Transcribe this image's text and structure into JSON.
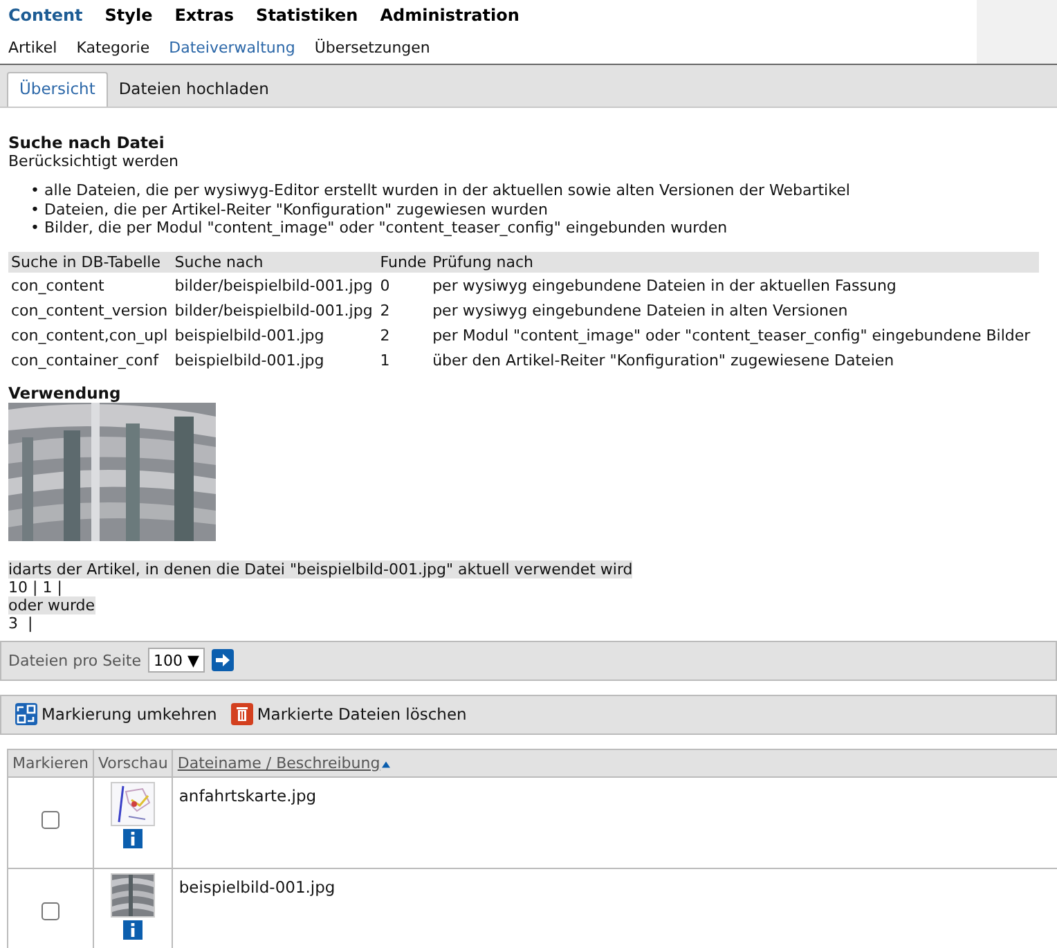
{
  "main_menu": [
    {
      "label": "Content",
      "selected": true
    },
    {
      "label": "Style",
      "selected": false
    },
    {
      "label": "Extras",
      "selected": false
    },
    {
      "label": "Statistiken",
      "selected": false
    },
    {
      "label": "Administration",
      "selected": false
    }
  ],
  "sub_menu": [
    {
      "label": "Artikel",
      "selected": false
    },
    {
      "label": "Kategorie",
      "selected": false
    },
    {
      "label": "Dateiverwaltung",
      "selected": true
    },
    {
      "label": "Übersetzungen",
      "selected": false
    }
  ],
  "tabs": [
    {
      "label": "Übersicht",
      "selected": true
    },
    {
      "label": "Dateien hochladen",
      "selected": false
    }
  ],
  "search": {
    "heading": "Suche nach Datei",
    "intro": "Berücksichtigt werden",
    "bullet_marker": "•",
    "bullets": [
      "alle Dateien, die per wysiwyg-Editor erstellt wurden in der aktuellen sowie alten Versionen der Webartikel",
      "Dateien, die per Artikel-Reiter \"Konfiguration\" zugewiesen wurden",
      "Bilder, die per Modul \"content_image\" oder \"content_teaser_config\" eingebunden wurden"
    ],
    "table": {
      "columns": [
        "Suche in DB-Tabelle",
        "Suche nach",
        "Funde",
        "Prüfung nach"
      ],
      "rows": [
        [
          "con_content",
          "bilder/beispielbild-001.jpg",
          "0",
          "per wysiwyg eingebundene Dateien in der aktuellen Fassung"
        ],
        [
          "con_content_version",
          "bilder/beispielbild-001.jpg",
          "2",
          "per wysiwyg eingebundene Dateien in alten Versionen"
        ],
        [
          "con_content,con_upl",
          "beispielbild-001.jpg",
          "2",
          "per Modul \"content_image\" oder \"content_teaser_config\" eingebundene Bilder"
        ],
        [
          "con_container_conf",
          "beispielbild-001.jpg",
          "1",
          "über den Artikel-Reiter \"Konfiguration\" zugewiesene Dateien"
        ]
      ]
    }
  },
  "usage": {
    "heading": "Verwendung",
    "current_label": "idarts der Artikel, in denen die Datei \"beispielbild-001.jpg\" aktuell verwendet wird",
    "current_ids": "10 | 1 |",
    "former_label": "oder wurde",
    "former_ids": "3  |"
  },
  "pagination": {
    "label": "Dateien pro Seite",
    "per_page": "100 ▼"
  },
  "actions": [
    "Markierung umkehren",
    "Markierte Dateien löschen"
  ],
  "files": {
    "columns": [
      "Markieren",
      "Vorschau",
      "Dateiname / Beschreibung"
    ],
    "rows": [
      {
        "checked": false,
        "name": "anfahrtskarte.jpg"
      },
      {
        "checked": false,
        "name": "beispielbild-001.jpg"
      }
    ]
  }
}
